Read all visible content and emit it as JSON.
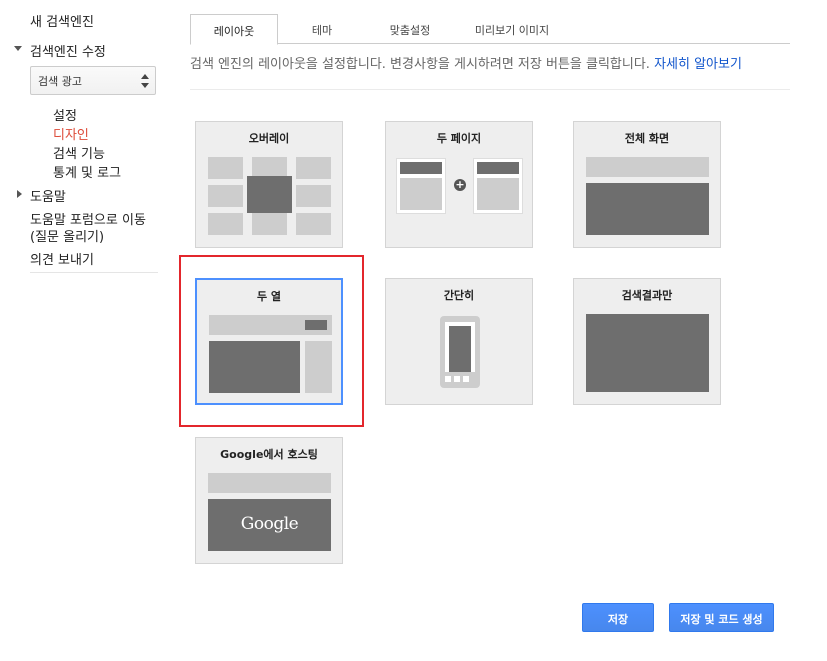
{
  "sidebar": {
    "new_engine": "새 검색엔진",
    "edit_engine": "검색엔진 수정",
    "engine_select": "검색 광고",
    "sub_items": [
      "설정",
      "디자인",
      "검색 기능",
      "통계 및 로그"
    ],
    "help": "도움말",
    "help_forum_line1": "도움말 포럼으로 이동",
    "help_forum_line2": "(질문 올리기)",
    "feedback": "의견 보내기"
  },
  "tabs": [
    "레이아웃",
    "테마",
    "맞춤설정",
    "미리보기 이미지"
  ],
  "description": {
    "text": "검색 엔진의 레이아웃을 설정합니다. 변경사항을 게시하려면 저장 버튼을 클릭합니다.",
    "link": "자세히 알아보기"
  },
  "layouts": [
    {
      "title": "오버레이"
    },
    {
      "title": "두 페이지"
    },
    {
      "title": "전체 화면"
    },
    {
      "title": "두 열",
      "selected": true
    },
    {
      "title": "간단히"
    },
    {
      "title": "검색결과만"
    },
    {
      "title": "Google에서 호스팅",
      "logo_text": "Google"
    }
  ],
  "buttons": {
    "save": "저장",
    "save_and_code": "저장 및 코드 생성"
  },
  "colors": {
    "accent_blue": "#4d90fe",
    "active_red": "#dd4b39",
    "highlight_red": "#e3262c",
    "link_blue": "#1155cc"
  }
}
